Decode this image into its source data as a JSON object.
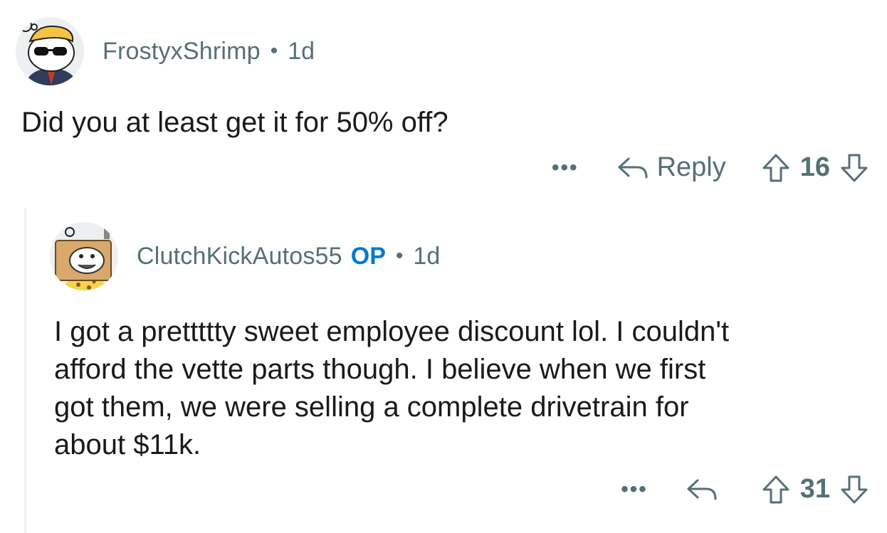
{
  "comments": [
    {
      "username": "FrostyxShrimp",
      "separator": "•",
      "time": "1d",
      "body": "Did you at least get it for 50% off?",
      "more_label": "•••",
      "reply_label": "Reply",
      "score": "16"
    },
    {
      "username": "ClutchKickAutos55",
      "op_badge": "OP",
      "separator": "•",
      "time": "1d",
      "body_lines": [
        "I got a prettttty sweet employee discount lol. I couldn't",
        "afford the vette parts though. I believe when we first",
        "got them, we were selling a complete drivetrain for",
        "about $11k."
      ],
      "more_label": "•••",
      "score": "31"
    }
  ],
  "icons": [
    "snoo-avatar-icon",
    "reply-arrow-icon",
    "upvote-icon",
    "downvote-icon",
    "more-options-icon"
  ],
  "colors": {
    "meta": "#576f76",
    "op": "#0079d3",
    "text": "#1a1a1b",
    "thread": "#edeff1"
  }
}
